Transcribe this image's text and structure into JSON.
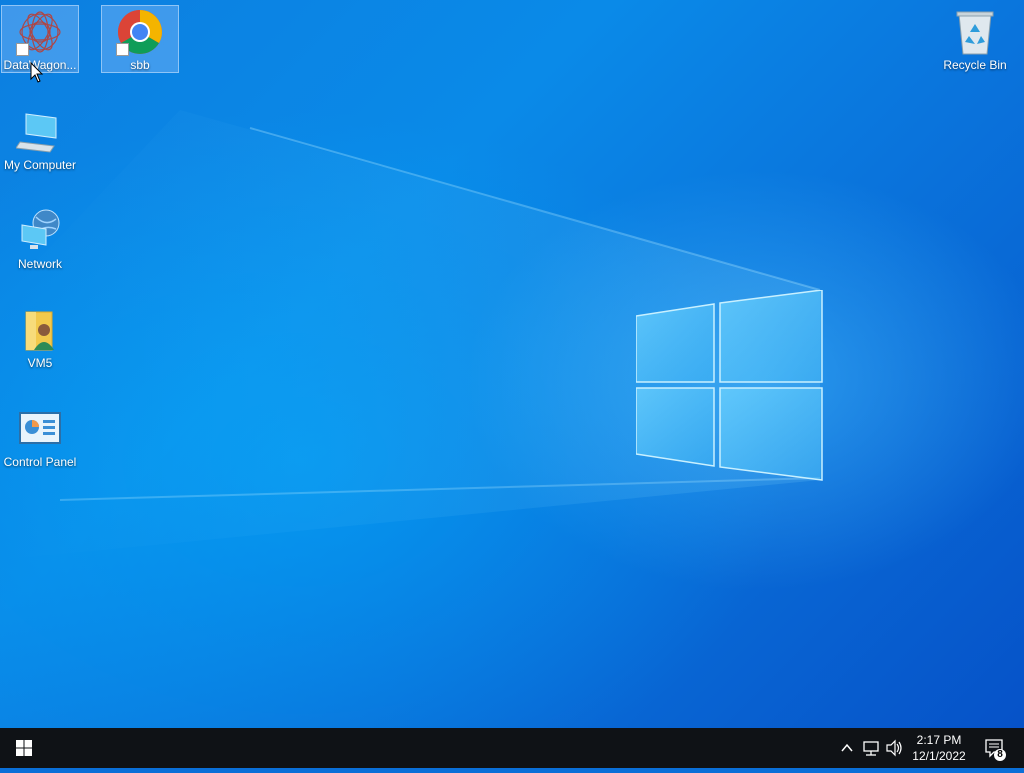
{
  "desktop": {
    "icons": [
      {
        "label": "DataWagon...",
        "icon": "datawagon-icon",
        "selected": true
      },
      {
        "label": "sbb",
        "icon": "chrome-icon",
        "selected": true
      },
      {
        "label": "My Computer",
        "icon": "computer-icon",
        "selected": false
      },
      {
        "label": "Network",
        "icon": "network-icon",
        "selected": false
      },
      {
        "label": "VM5",
        "icon": "user-folder-icon",
        "selected": false
      },
      {
        "label": "Control Panel",
        "icon": "control-panel-icon",
        "selected": false
      },
      {
        "label": "Recycle Bin",
        "icon": "recycle-bin-icon",
        "selected": false
      }
    ]
  },
  "taskbar": {
    "time": "2:17 PM",
    "date": "12/1/2022",
    "notification_count": "8"
  },
  "colors": {
    "taskbar": "#0f1216",
    "wallpaper_accent": "#0a8ae8"
  }
}
